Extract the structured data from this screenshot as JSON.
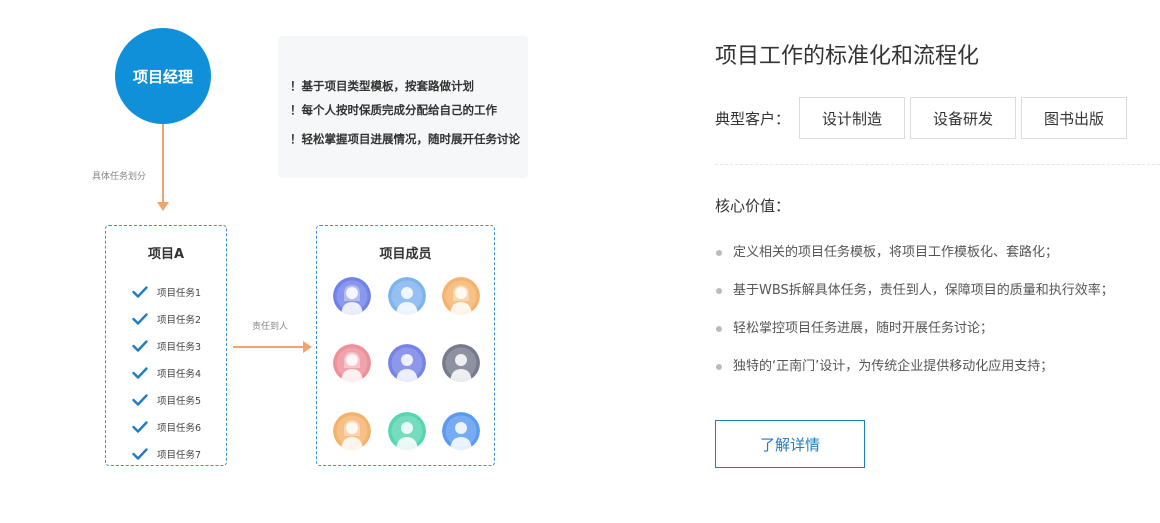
{
  "diagram": {
    "manager_label": "项目经理",
    "split_label": "具体任务划分",
    "info_lines": [
      "！基于项目类型模板，按套路做计划",
      "！每个人按时保质完成分配给自己的工作",
      "！轻松掌握项目进展情况，随时展开任务讨论"
    ],
    "project": {
      "title": "项目A",
      "tasks": [
        "项目任务1",
        "项目任务2",
        "项目任务3",
        "项目任务4",
        "项目任务5",
        "项目任务6",
        "项目任务7"
      ]
    },
    "assign_label": "责任到人",
    "members": {
      "title": "项目成员",
      "avatars": [
        {
          "icon": "person-female-icon",
          "color": "#6f82e8"
        },
        {
          "icon": "person-male-icon",
          "color": "#7fb3ee"
        },
        {
          "icon": "person-female-icon",
          "color": "#f4b36c"
        },
        {
          "icon": "person-female-icon",
          "color": "#ee8f99"
        },
        {
          "icon": "person-male-icon",
          "color": "#7582e6"
        },
        {
          "icon": "person-male-icon",
          "color": "#767a8c"
        },
        {
          "icon": "person-female-icon",
          "color": "#f4b36c"
        },
        {
          "icon": "person-male-icon",
          "color": "#57d5b0"
        },
        {
          "icon": "person-male-icon",
          "color": "#5b9af0"
        }
      ]
    }
  },
  "content": {
    "title": "项目工作的标准化和流程化",
    "customers_label": "典型客户：",
    "customers": [
      "设计制造",
      "设备研发",
      "图书出版"
    ],
    "values_label": "核心价值：",
    "values": [
      "定义相关的项目任务模板，将项目工作模板化、套路化；",
      "基于WBS拆解具体任务，责任到人，保障项目的质量和执行效率；",
      "轻松掌控项目任务进展，随时开展任务讨论；",
      "独特的‘正南门’设计，为传统企业提供移动化应用支持；"
    ],
    "detail_button": "了解详情"
  },
  "colors": {
    "primary": "#1090d8",
    "arrow": "#f0a36b",
    "dashed_border": "#3d8fd6",
    "check": "#1f7dc1",
    "button": "#1f7dc1"
  }
}
